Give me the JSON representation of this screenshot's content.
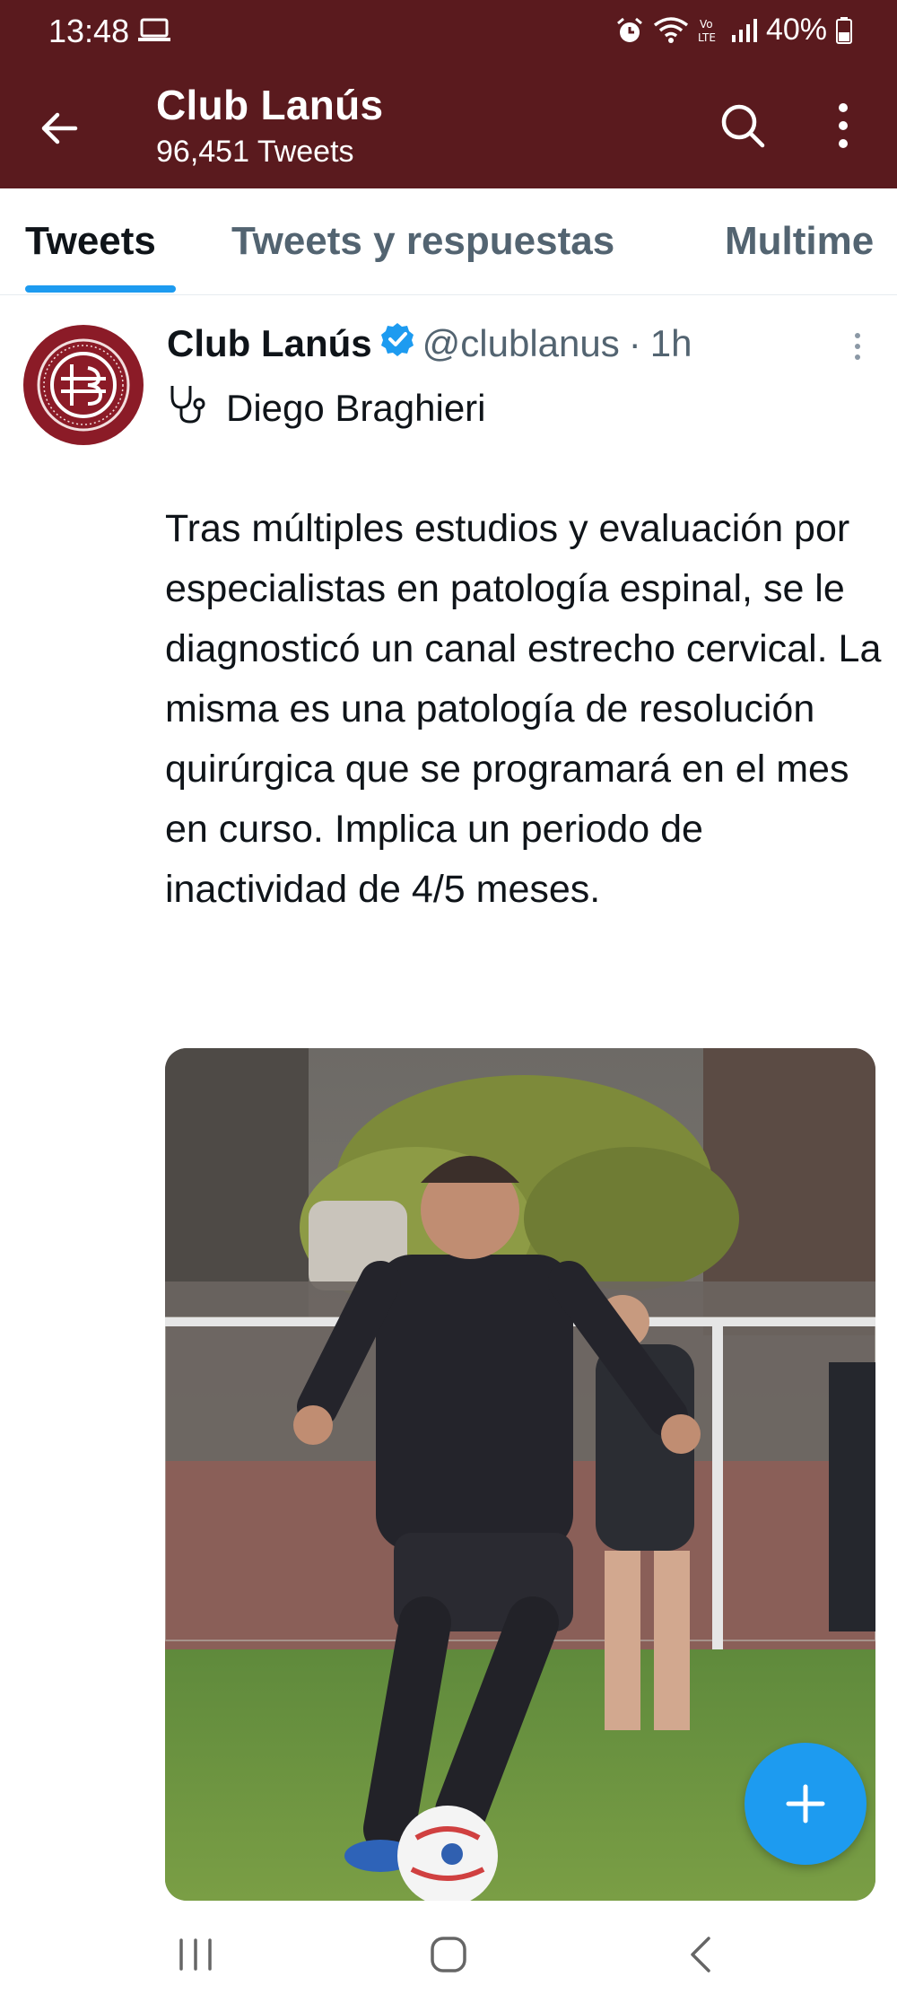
{
  "status_bar": {
    "time": "13:48",
    "battery": "40%",
    "icons": [
      "laptop-icon",
      "alarm-icon",
      "wifi-icon",
      "volte-icon",
      "signal-icon",
      "battery-icon"
    ]
  },
  "header": {
    "title": "Club Lanús",
    "subtitle": "96,451 Tweets",
    "icons": [
      "back-arrow-icon",
      "search-icon",
      "more-vertical-icon"
    ]
  },
  "tabs": [
    {
      "label": "Tweets",
      "active": true
    },
    {
      "label": "Tweets y respuestas",
      "active": false
    },
    {
      "label": "Multime",
      "active": false
    }
  ],
  "tweet": {
    "author_name": "Club Lanús",
    "handle": "@clublanus",
    "separator": "·",
    "time": "1h",
    "line1_icon": "stethoscope-icon",
    "line1_text": "Diego Braghieri",
    "body": "Tras múltiples estudios y evaluación por especialistas en patología espinal, se le diagnosticó un canal estrecho cervical. La misma es una patología de resolución quirúrgica que se programará en el mes en curso. Implica un periodo de inactividad de 4/5 meses."
  },
  "fab": {
    "icon": "plus-icon"
  },
  "nav_bar": {
    "icons": [
      "recent-apps-icon",
      "home-icon",
      "back-icon"
    ]
  },
  "colors": {
    "header_bg": "#5a1a1e",
    "accent_blue": "#1d9bf0",
    "avatar_bg": "#8b1b27",
    "secondary_text": "#536471"
  }
}
